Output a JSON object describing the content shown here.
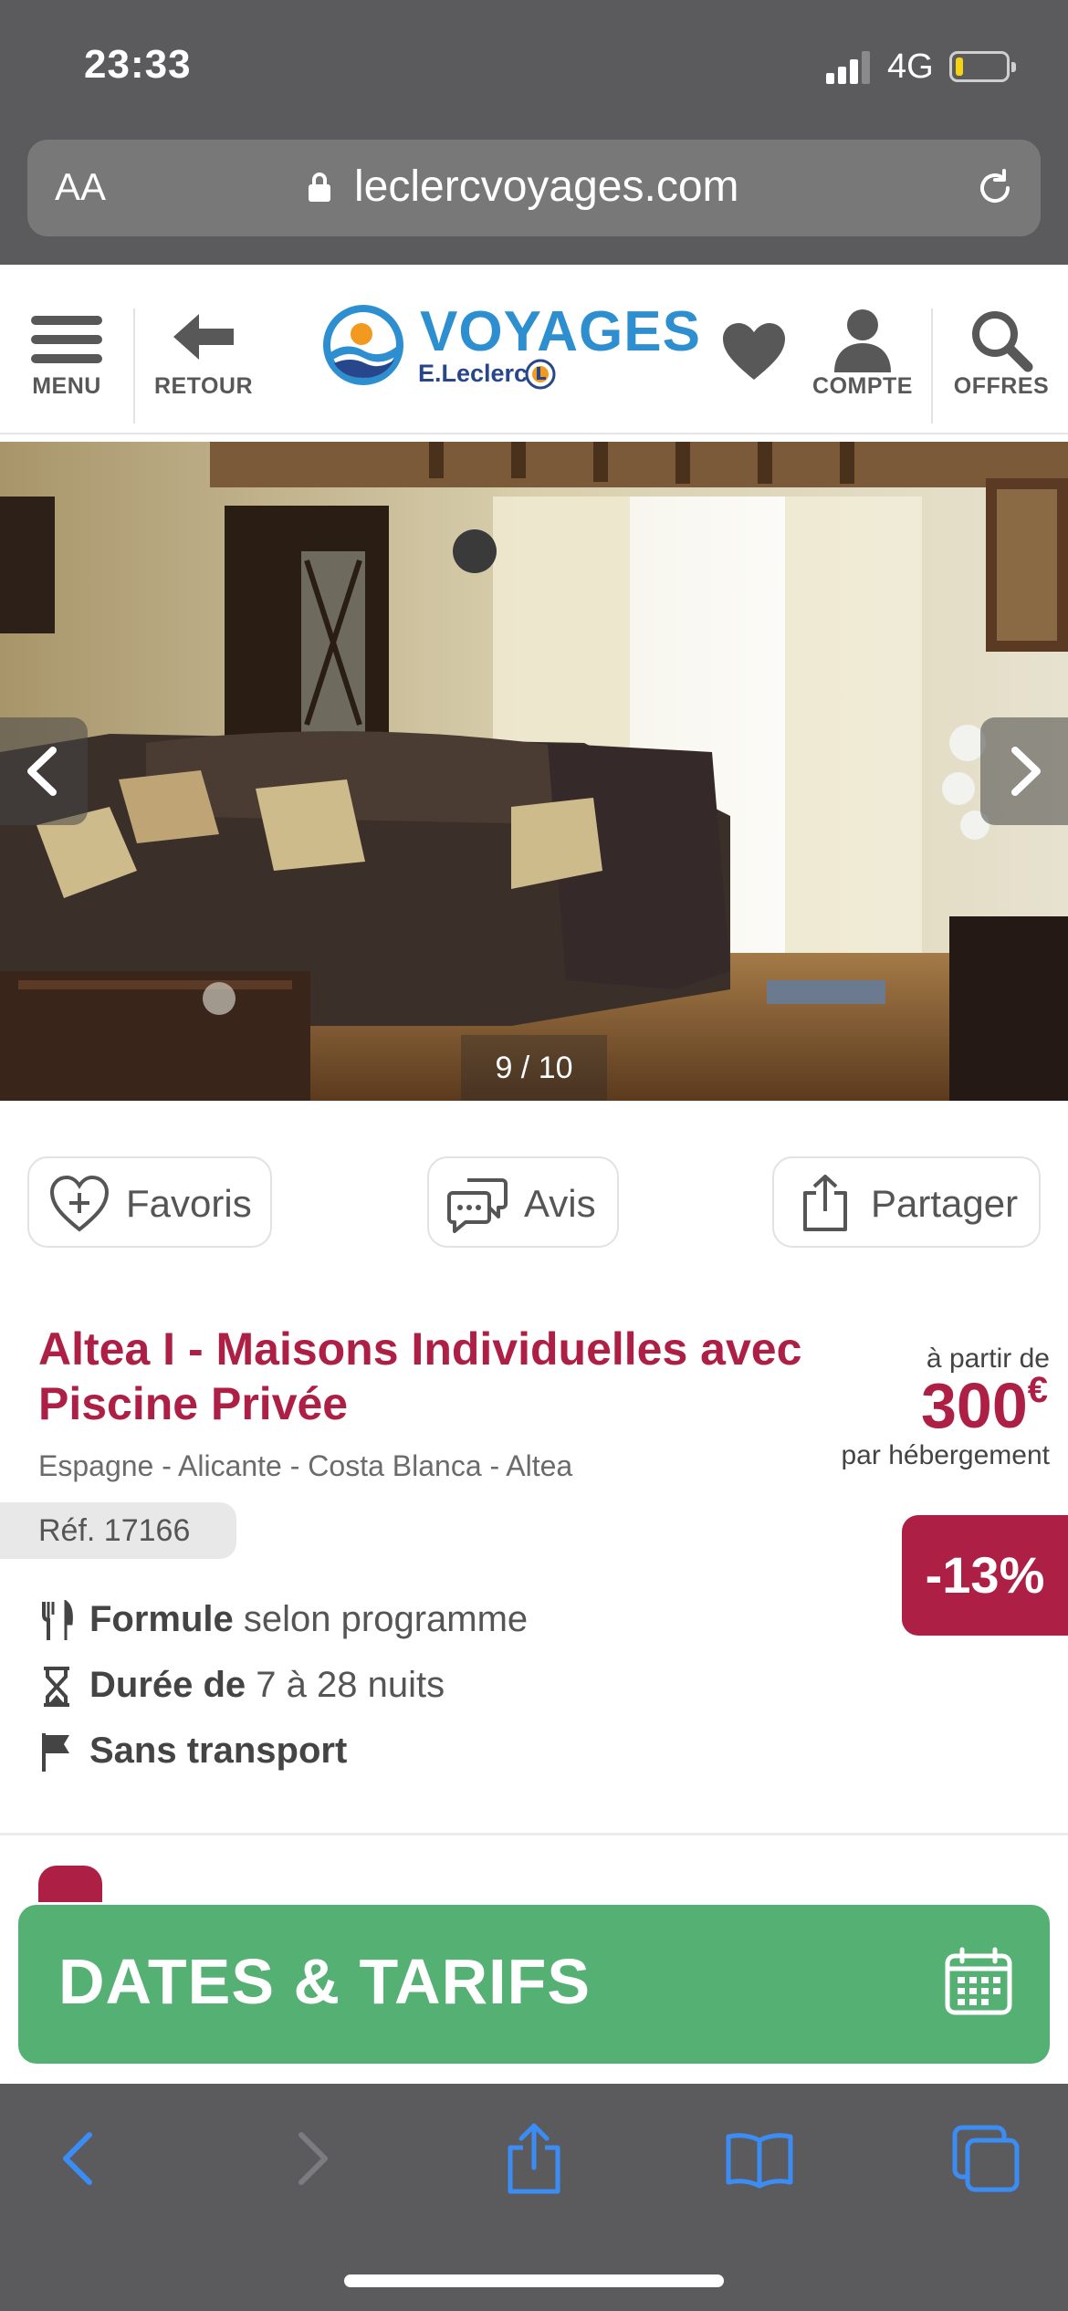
{
  "status_bar": {
    "time": "23:33",
    "network": "4G",
    "battery_level": 0.15,
    "battery_color": "#f5d312"
  },
  "browser": {
    "text_size_label": "AA",
    "url": "leclercvoyages.com",
    "secure_icon": "lock-icon",
    "reload_icon": "reload-icon"
  },
  "header": {
    "menu_label": "MENU",
    "back_label": "RETOUR",
    "logo_title": "VOYAGES",
    "logo_subtitle": "E.Leclerc",
    "account_label": "COMPTE",
    "offers_label": "OFFRES",
    "icons": [
      "hamburger-icon",
      "back-arrow-icon",
      "heart-icon",
      "user-icon",
      "search-icon"
    ]
  },
  "gallery": {
    "counter": "9 / 10",
    "current": 9,
    "total": 10,
    "prev_icon": "chevron-left-icon",
    "next_icon": "chevron-right-icon"
  },
  "actions": {
    "favorites_label": "Favoris",
    "reviews_label": "Avis",
    "share_label": "Partager"
  },
  "product": {
    "title": "Altea I - Maisons Individuelles avec Piscine Privée",
    "location": "Espagne - Alicante - Costa Blanca - Altea",
    "reference": "Réf. 17166",
    "price_from": "à partir de",
    "price": "300",
    "currency": "€",
    "price_per": "par hébergement",
    "discount": "-13%",
    "accent_color": "#ad1f45",
    "features": [
      {
        "icon": "cutlery-icon",
        "bold": "Formule",
        "text": " selon programme"
      },
      {
        "icon": "hourglass-icon",
        "bold": "Durée de",
        "text": " 7 à 28 nuits"
      },
      {
        "icon": "flag-icon",
        "bold": "Sans transport",
        "text": ""
      }
    ]
  },
  "cta": {
    "label": "DATES & TARIFS",
    "color": "#55b073",
    "icon": "calendar-icon"
  },
  "safari_toolbar": {
    "icons": [
      "back-icon",
      "forward-icon",
      "share-icon",
      "bookmarks-icon",
      "tabs-icon"
    ],
    "tint": "#3b8cf5"
  }
}
